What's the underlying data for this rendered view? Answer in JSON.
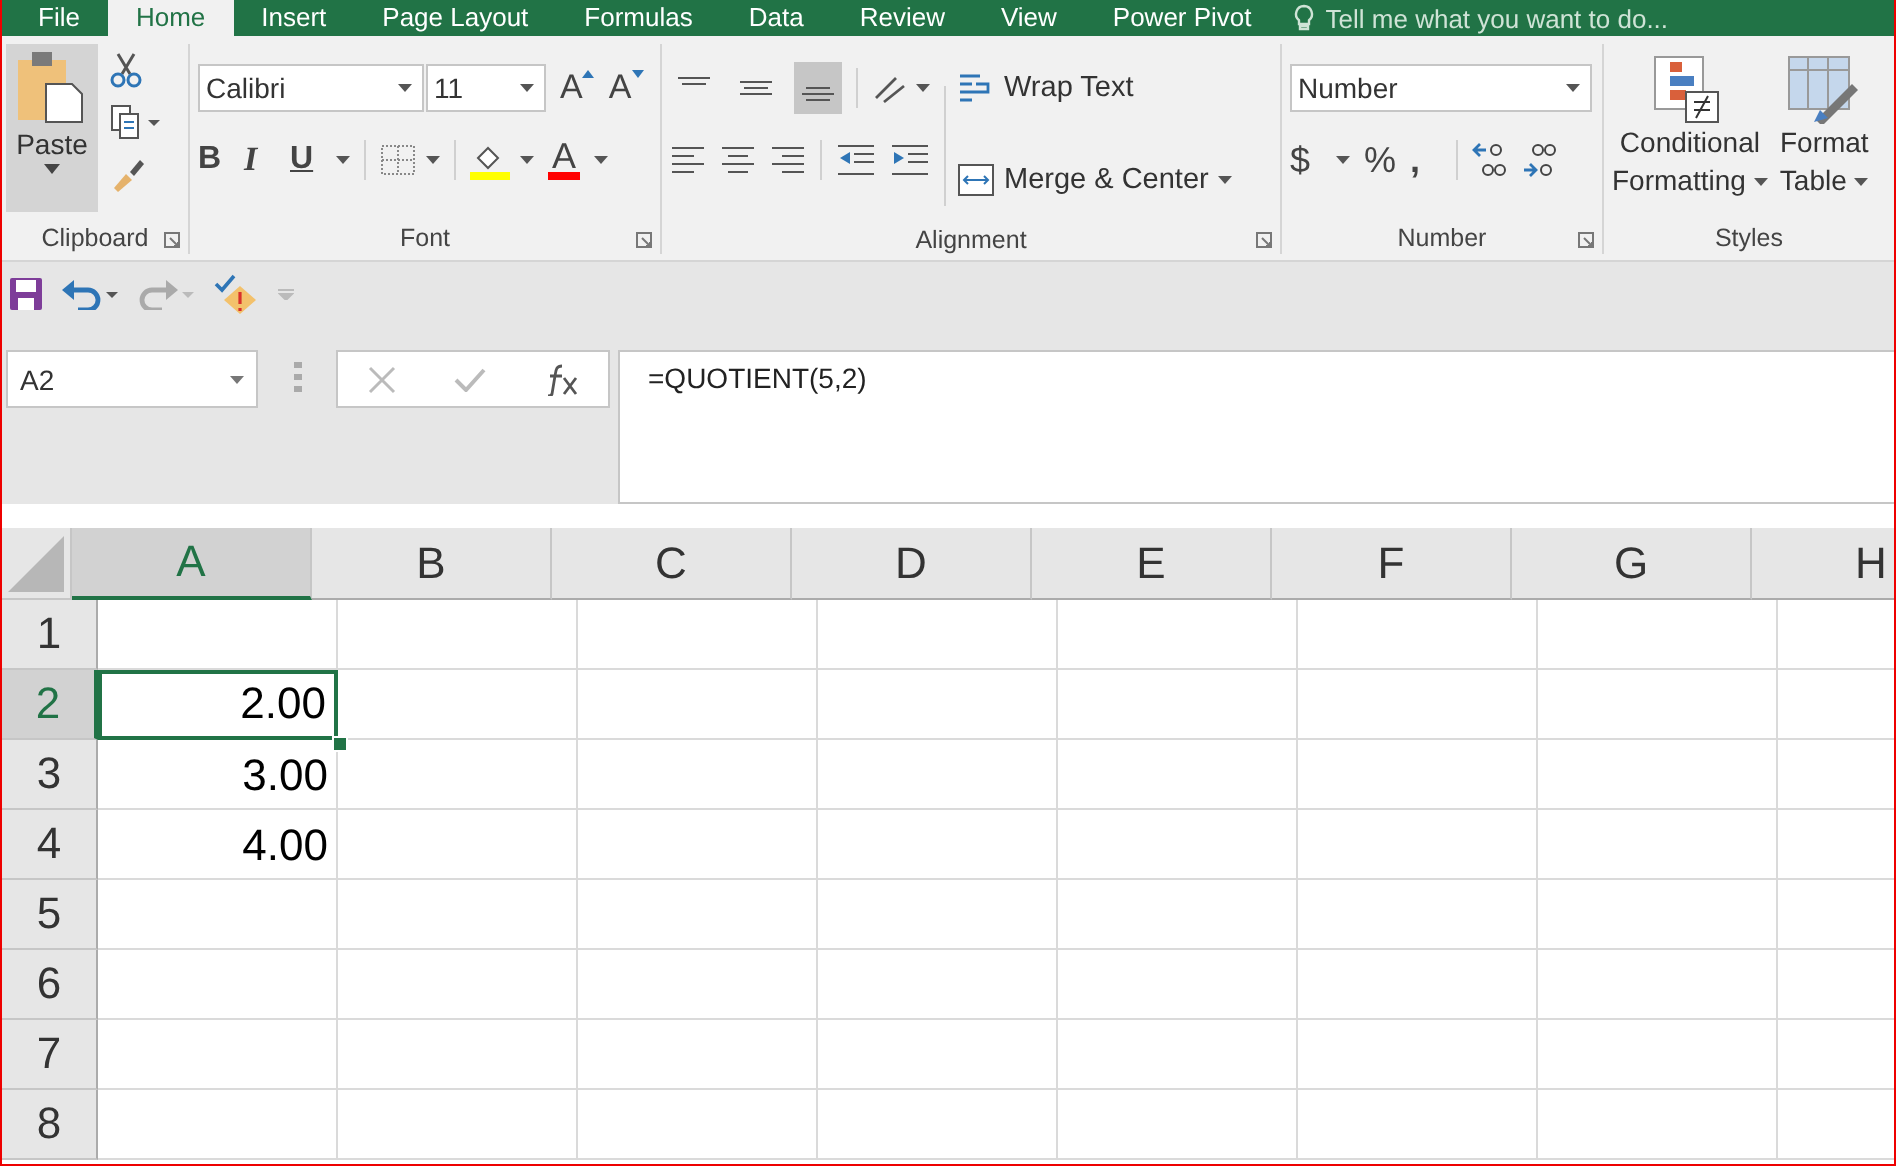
{
  "tabs": [
    {
      "label": "File",
      "selected": false
    },
    {
      "label": "Home",
      "selected": true
    },
    {
      "label": "Insert",
      "selected": false
    },
    {
      "label": "Page Layout",
      "selected": false
    },
    {
      "label": "Formulas",
      "selected": false
    },
    {
      "label": "Data",
      "selected": false
    },
    {
      "label": "Review",
      "selected": false
    },
    {
      "label": "View",
      "selected": false
    },
    {
      "label": "Power Pivot",
      "selected": false
    }
  ],
  "tell_me": "Tell me what you want to do...",
  "ribbon": {
    "clipboard": {
      "paste": "Paste",
      "label": "Clipboard"
    },
    "font": {
      "font_name": "Calibri",
      "font_size": "11",
      "grow": "A",
      "shrink": "A",
      "bold": "B",
      "italic": "I",
      "underline": "U",
      "font_color": "A",
      "label": "Font"
    },
    "alignment": {
      "vertical": [
        {
          "selected": false
        },
        {
          "selected": false
        },
        {
          "selected": true
        }
      ],
      "wrap_text": "Wrap Text",
      "merge_center": "Merge & Center",
      "label": "Alignment"
    },
    "number": {
      "format": "Number",
      "currency": "$",
      "percent": "%",
      "comma": ",",
      "label": "Number"
    },
    "styles": {
      "conditional": [
        "Conditional",
        "Formatting"
      ],
      "format_table": [
        "Format",
        "Table"
      ],
      "label": "Styles"
    }
  },
  "formula_bar": {
    "name_box": "A2",
    "formula": "=QUOTIENT(5,2)"
  },
  "grid": {
    "columns": [
      {
        "label": "A",
        "selected": true
      },
      {
        "label": "B",
        "selected": false
      },
      {
        "label": "C",
        "selected": false
      },
      {
        "label": "D",
        "selected": false
      },
      {
        "label": "E",
        "selected": false
      },
      {
        "label": "F",
        "selected": false
      },
      {
        "label": "G",
        "selected": false
      },
      {
        "label": "H",
        "selected": false
      }
    ],
    "rows": [
      {
        "label": "1",
        "selected": false
      },
      {
        "label": "2",
        "selected": true,
        "cells": [
          "2.00"
        ]
      },
      {
        "label": "3",
        "selected": false,
        "cells": [
          "3.00"
        ]
      },
      {
        "label": "4",
        "selected": false,
        "cells": [
          "4.00"
        ]
      },
      {
        "label": "5",
        "selected": false
      },
      {
        "label": "6",
        "selected": false
      },
      {
        "label": "7",
        "selected": false
      },
      {
        "label": "8",
        "selected": false
      }
    ]
  }
}
